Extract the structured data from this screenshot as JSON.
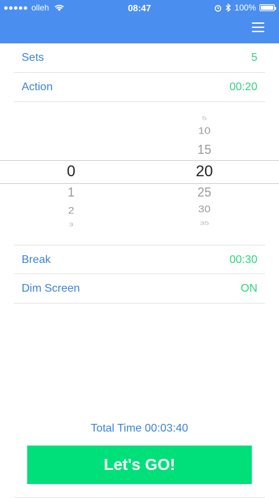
{
  "status_bar": {
    "carrier": "olleh",
    "time": "08:47",
    "battery": "100%",
    "icons": [
      "signal-dots-icon",
      "wifi-icon",
      "alarm-icon",
      "bluetooth-icon",
      "battery-icon"
    ]
  },
  "nav": {
    "menu_icon": "hamburger-menu-icon"
  },
  "settings": {
    "sets": {
      "label": "Sets",
      "value": "5"
    },
    "action": {
      "label": "Action",
      "value": "00:20"
    },
    "break": {
      "label": "Break",
      "value": "00:30"
    },
    "dim_screen": {
      "label": "Dim Screen",
      "value": "ON"
    }
  },
  "picker": {
    "minutes": {
      "selected": "0",
      "below": [
        "1",
        "2",
        "3"
      ]
    },
    "seconds": {
      "above": [
        "5",
        "10",
        "15"
      ],
      "selected": "20",
      "below": [
        "25",
        "30",
        "35"
      ]
    }
  },
  "footer": {
    "total_time": "Total Time 00:03:40",
    "go_label": "Let's GO!"
  },
  "colors": {
    "primary_blue": "#4a8ef0",
    "label_blue": "#3a82d8",
    "value_green": "#2bd67b",
    "button_green": "#00e07a"
  }
}
